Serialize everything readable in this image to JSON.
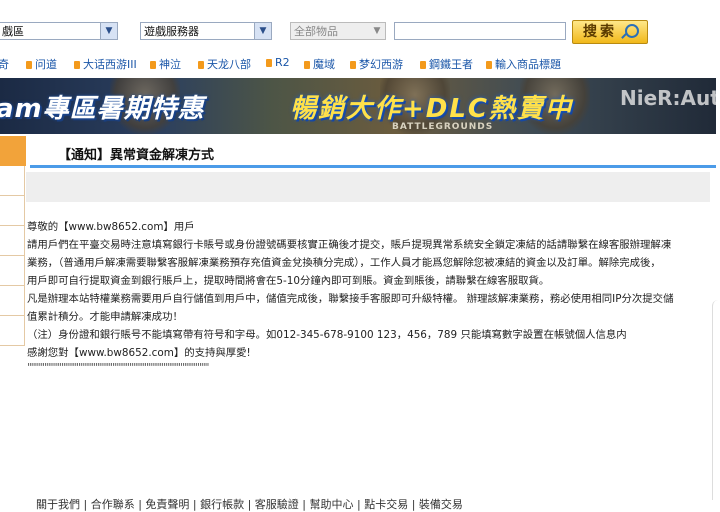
{
  "search": {
    "region_value": "戲區",
    "server_value": "遊戲服務器",
    "category_value": "全部物品",
    "keyword_placeholder": "",
    "search_label": "搜索"
  },
  "nav": {
    "items": [
      {
        "label": "奇",
        "bullet": false
      },
      {
        "label": "问道",
        "bullet": true
      },
      {
        "label": "大话西游III",
        "bullet": true
      },
      {
        "label": "神泣",
        "bullet": true
      },
      {
        "label": "天龙八部",
        "bullet": true
      },
      {
        "label": "R2",
        "bullet": true
      },
      {
        "label": "魔域",
        "bullet": true
      },
      {
        "label": "梦幻西游",
        "bullet": true
      },
      {
        "label": "鋼鐵王者",
        "bullet": true
      },
      {
        "label": "輸入商品標題",
        "bullet": true
      }
    ]
  },
  "banner": {
    "left_text": "am專區暑期特惠",
    "main_text": "暢銷大作+DLC熱賣中",
    "game_caption": "BATTLEGROUNDS",
    "right_text": "NieR:Automat"
  },
  "notice": {
    "title": "【通知】異常資金解凍方式",
    "lines": [
      "尊敬的【www.bw8652.com】用戶",
      "請用戶們在平臺交易時注意填寫銀行卡賬号或身份證號碼要核實正确後才提交，賬戶提現異常系統安全鎖定凍結的話請聯繫在線客服辦理解凍",
      "業務，（普通用戶解凍需要聯繫客服解凍業務預存充值資金兌換積分完成），工作人員才能爲您解除您被凍結的資金以及訂單。解除完成後，",
      "用戶即可自行提取資金到銀行賬戶上，提取時間將會在5-10分鐘內即可到賬。資金到賬後，請聯繫在線客服取貨。",
      "凡是辦理本站特權業務需要用戶自行儲值到用戶中，儲值完成後，聯繫接手客服即可升級特權。 辦理該解凍業務，務必使用相同IP分次提交儲",
      "值累計積分。才能申請解凍成功！",
      "（注）身份證和銀行賬号不能填寫帶有符号和字母。如012-345-678-9100 123，456，789 只能填寫數字設置在帳號個人信息内",
      "感謝您對【www.bw8652.com】的支持與厚愛!"
    ],
    "trailing_quotes": "\"\"\"\"\"\"\"\"\"\"\"\"\"\"\"\"\"\"\"\"\"\"\"\"\"\"\"\"\"\"\"\"\"\"\"\"\"\"\"\"\"\"\"\"\"\"\"\""
  },
  "footer": {
    "text": "關于我們 | 合作聯系 | 免責聲明 | 銀行帳款 | 客服驗證 | 幫助中心 | 點卡交易 | 裝備交易"
  },
  "colors": {
    "link": "#1a56a8",
    "accent_orange": "#f2a33a",
    "title_rule": "#4b9be8",
    "button_gold": "#f1b81a"
  }
}
